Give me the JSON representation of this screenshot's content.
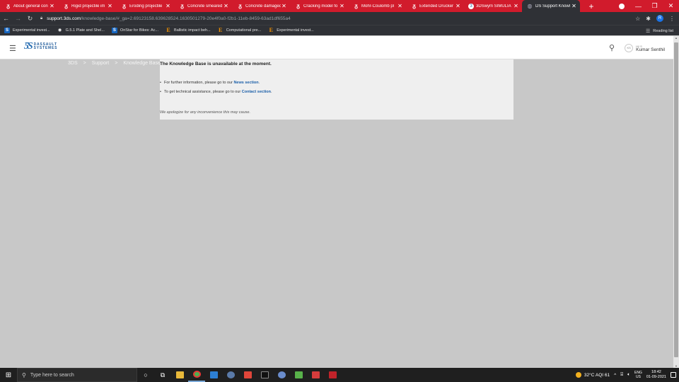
{
  "browser": {
    "tabs": [
      {
        "title": "About general con",
        "icon": "ds-icon"
      },
      {
        "title": "Rigid projectile im",
        "icon": "ds-icon"
      },
      {
        "title": "Eroding projectile",
        "icon": "ds-icon"
      },
      {
        "title": "Concrete smeared",
        "icon": "ds-icon"
      },
      {
        "title": "Concrete damaged",
        "icon": "ds-icon"
      },
      {
        "title": "Cracking model fo",
        "icon": "ds-icon"
      },
      {
        "title": "Mohr-Coulomb pl",
        "icon": "ds-icon"
      },
      {
        "title": "Extended Drucker",
        "icon": "ds-icon"
      },
      {
        "title": "3DSwym SIMULIA",
        "icon": "swym-icon"
      },
      {
        "title": "DS Support Knowl",
        "icon": "globe-icon",
        "active": true
      }
    ],
    "url_host": "support.3ds.com",
    "url_path": "/knowledge-base/#_ga=2.69123158.639628524.1630501279-20e4f0a0-f2b1-11eb-8459-63ad1df655a4",
    "profile_initial": "R",
    "bookmarks": [
      {
        "label": "Experimental invest...",
        "icon": "s-icon"
      },
      {
        "label": "G.5.1 Plate and Shel...",
        "icon": "globe-icon"
      },
      {
        "label": "OnStar for Bikes: Ac...",
        "icon": "s-icon"
      },
      {
        "label": "Ballistic impact beh...",
        "icon": "e-icon"
      },
      {
        "label": "Computational pre...",
        "icon": "e-icon"
      },
      {
        "label": "Experimental invest...",
        "icon": "e-icon"
      }
    ],
    "reading_list": "Reading list"
  },
  "site": {
    "logo_line1": "DASSAULT",
    "logo_line2": "SYSTEMES",
    "user_greeting": "Hi! S",
    "user_name": "Kumar Senthil",
    "user_initials": "KS"
  },
  "breadcrumb": [
    "3DS",
    ">",
    "Support",
    ">",
    "Knowledge Base"
  ],
  "notice": {
    "title": "The Knowledge Base is unavailable at the moment.",
    "item1_text": "For further information, please go to our ",
    "item1_link": "News section",
    "item1_end": ".",
    "item2_text": "To get technical assistance, please go to our ",
    "item2_link": "Contact section",
    "item2_end": ".",
    "apology": "We apologize for any inconvenience this may cause."
  },
  "taskbar": {
    "search_placeholder": "Type here to search",
    "weather": "32°C  AQI 61",
    "lang1": "ENG",
    "lang2": "US",
    "time": "18:42",
    "date": "01-09-2021"
  },
  "colors": {
    "tabbar": "#d11b2c",
    "chrome_dark": "#2f3136",
    "link": "#1a5ea8",
    "overlay": "#c8c8c8"
  }
}
